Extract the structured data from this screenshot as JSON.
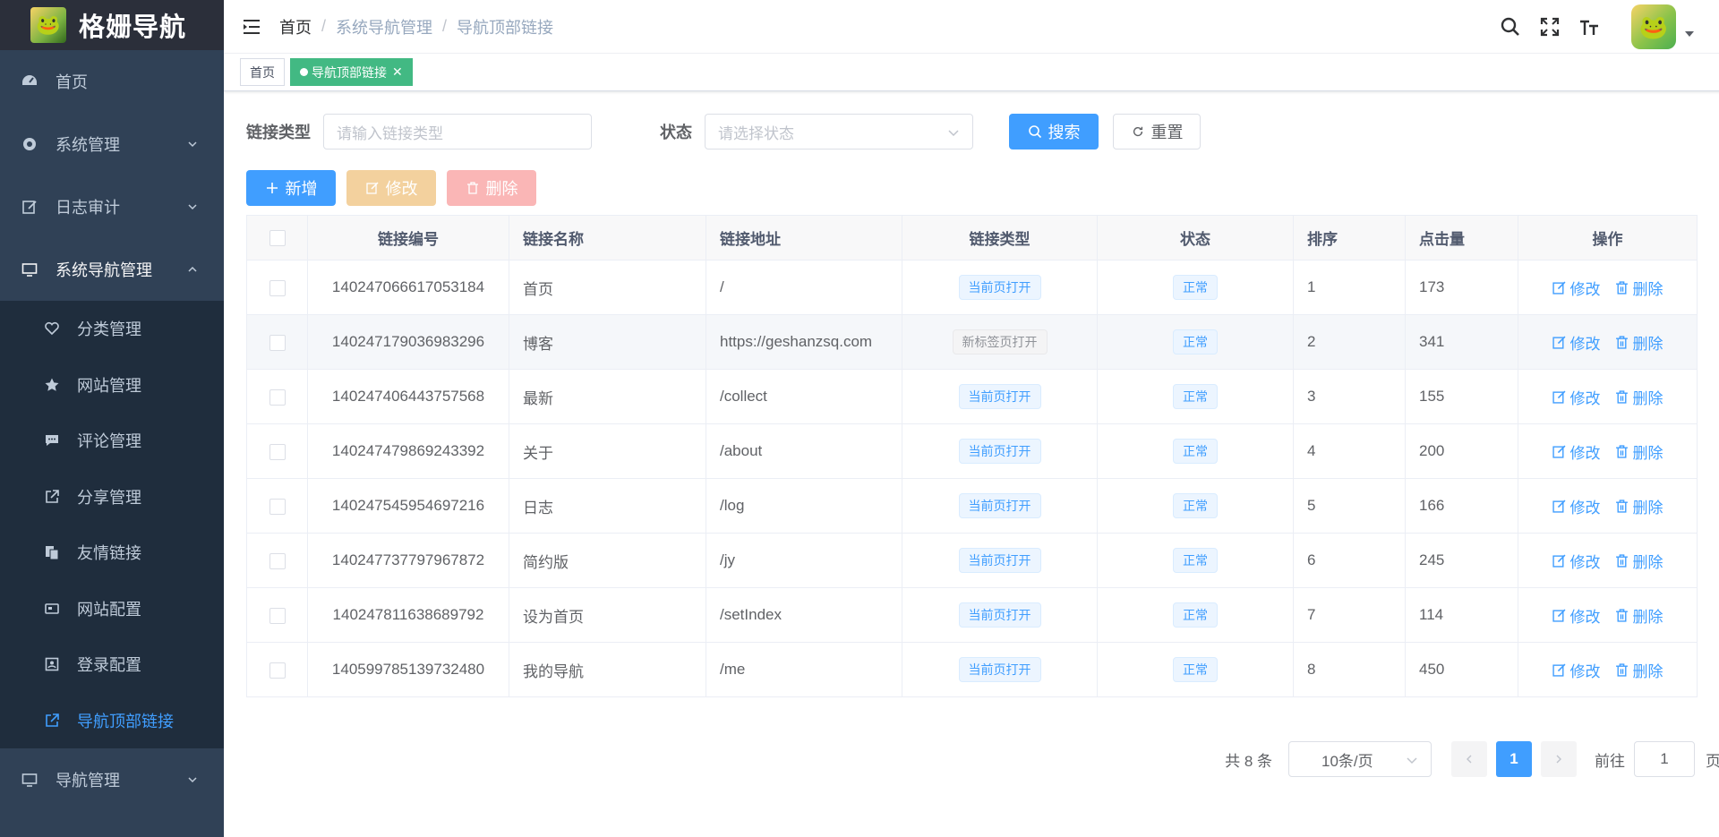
{
  "app": {
    "title": "格姗导航"
  },
  "sidebar": {
    "home": "首页",
    "system": "系统管理",
    "log": "日志审计",
    "nav_admin": "系统导航管理",
    "sub": [
      "分类管理",
      "网站管理",
      "评论管理",
      "分享管理",
      "友情链接",
      "网站配置",
      "登录配置",
      "导航顶部链接"
    ],
    "nav": "导航管理"
  },
  "breadcrumb": [
    "首页",
    "系统导航管理",
    "导航顶部链接"
  ],
  "tags": {
    "home": "首页",
    "active": "导航顶部链接"
  },
  "search": {
    "type_label": "链接类型",
    "type_placeholder": "请输入链接类型",
    "status_label": "状态",
    "status_placeholder": "请选择状态",
    "search_btn": "搜索",
    "reset_btn": "重置"
  },
  "toolbar": {
    "add": "新增",
    "edit": "修改",
    "delete": "删除"
  },
  "table": {
    "headers": [
      "链接编号",
      "链接名称",
      "链接地址",
      "链接类型",
      "状态",
      "排序",
      "点击量",
      "操作"
    ],
    "rows": [
      {
        "id": "140247066617053184",
        "name": "首页",
        "url": "/",
        "type": "当前页打开",
        "status": "正常",
        "sort": "1",
        "clicks": "173"
      },
      {
        "id": "140247179036983296",
        "name": "博客",
        "url": "https://geshanzsq.com",
        "type": "新标签页打开",
        "status": "正常",
        "sort": "2",
        "clicks": "341"
      },
      {
        "id": "140247406443757568",
        "name": "最新",
        "url": "/collect",
        "type": "当前页打开",
        "status": "正常",
        "sort": "3",
        "clicks": "155"
      },
      {
        "id": "140247479869243392",
        "name": "关于",
        "url": "/about",
        "type": "当前页打开",
        "status": "正常",
        "sort": "4",
        "clicks": "200"
      },
      {
        "id": "140247545954697216",
        "name": "日志",
        "url": "/log",
        "type": "当前页打开",
        "status": "正常",
        "sort": "5",
        "clicks": "166"
      },
      {
        "id": "140247737797967872",
        "name": "简约版",
        "url": "/jy",
        "type": "当前页打开",
        "status": "正常",
        "sort": "6",
        "clicks": "245"
      },
      {
        "id": "140247811638689792",
        "name": "设为首页",
        "url": "/setIndex",
        "type": "当前页打开",
        "status": "正常",
        "sort": "7",
        "clicks": "114"
      },
      {
        "id": "140599785139732480",
        "name": "我的导航",
        "url": "/me",
        "type": "当前页打开",
        "status": "正常",
        "sort": "8",
        "clicks": "450"
      }
    ],
    "op_edit": "修改",
    "op_delete": "删除"
  },
  "pagination": {
    "total": "共 8 条",
    "page_size": "10条/页",
    "current": "1",
    "goto": "前往",
    "goto_value": "1",
    "page_suffix": "页"
  },
  "colors": {
    "sidebar": "#304156",
    "primary": "#409eff",
    "active_tag": "#42b983"
  }
}
